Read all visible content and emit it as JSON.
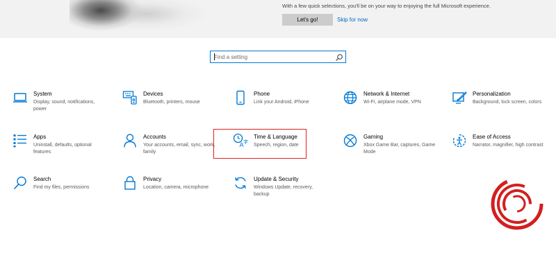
{
  "banner": {
    "text": "With a few quick selections, you'll be on your way to enjoying the full Microsoft experience.",
    "primary_button": "Let's go!",
    "secondary_link": "Skip for now"
  },
  "search": {
    "placeholder": "Find a setting",
    "icon": "search-icon"
  },
  "tiles": [
    {
      "id": "system",
      "title": "System",
      "desc": "Display, sound, notifications, power",
      "icon": "laptop-icon"
    },
    {
      "id": "devices",
      "title": "Devices",
      "desc": "Bluetooth, printers, mouse",
      "icon": "keyboard-icon"
    },
    {
      "id": "phone",
      "title": "Phone",
      "desc": "Link your Android, iPhone",
      "icon": "phone-icon"
    },
    {
      "id": "network",
      "title": "Network & Internet",
      "desc": "Wi-Fi, airplane mode, VPN",
      "icon": "globe-icon"
    },
    {
      "id": "personalization",
      "title": "Personalization",
      "desc": "Background, lock screen, colors",
      "icon": "paintbrush-icon"
    },
    {
      "id": "apps",
      "title": "Apps",
      "desc": "Uninstall, defaults, optional features",
      "icon": "apps-list-icon"
    },
    {
      "id": "accounts",
      "title": "Accounts",
      "desc": "Your accounts, email, sync, work, family",
      "icon": "person-icon"
    },
    {
      "id": "time-language",
      "title": "Time & Language",
      "desc": "Speech, region, date",
      "icon": "time-language-icon"
    },
    {
      "id": "gaming",
      "title": "Gaming",
      "desc": "Xbox Game Bar, captures, Game Mode",
      "icon": "xbox-icon"
    },
    {
      "id": "ease-of-access",
      "title": "Ease of Access",
      "desc": "Narrator, magnifier, high contrast",
      "icon": "ease-of-access-icon"
    },
    {
      "id": "search",
      "title": "Search",
      "desc": "Find my files, permissions",
      "icon": "search-icon"
    },
    {
      "id": "privacy",
      "title": "Privacy",
      "desc": "Location, camera, microphone",
      "icon": "lock-icon"
    },
    {
      "id": "update",
      "title": "Update & Security",
      "desc": "Windows Update, recovery, backup",
      "icon": "refresh-icon"
    }
  ],
  "colors": {
    "accent": "#0078d4",
    "highlight": "#e01e1e",
    "banner_bg": "#f2f2f2",
    "button_bg": "#cccccc",
    "link": "#0067c0"
  }
}
